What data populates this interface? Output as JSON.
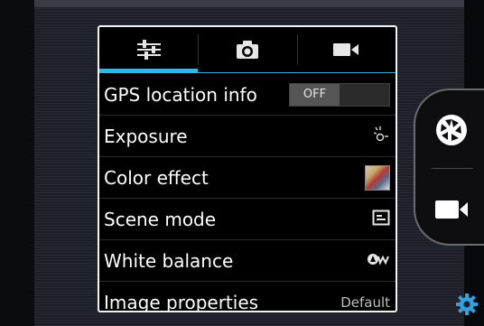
{
  "tabs": [
    {
      "icon": "settings-sliders-icon",
      "active": true
    },
    {
      "icon": "camera-icon",
      "active": false
    },
    {
      "icon": "video-camera-icon",
      "active": false
    }
  ],
  "settings": {
    "gps": {
      "label": "GPS location info",
      "value": "OFF"
    },
    "exposure": {
      "label": "Exposure",
      "icon": "exposure-icon"
    },
    "color_effect": {
      "label": "Color effect",
      "icon": "color-effect-thumbnail"
    },
    "scene_mode": {
      "label": "Scene mode",
      "icon": "scene-mode-icon"
    },
    "white_balance": {
      "label": "White balance",
      "icon": "auto-white-balance-icon"
    },
    "image_properties": {
      "label": "Image properties",
      "value": "Default"
    }
  },
  "controls": {
    "shutter_icon": "shutter-icon",
    "video_icon": "video-camera-icon",
    "settings_icon": "gear-icon"
  },
  "colors": {
    "accent": "#33b5e5",
    "panel_bg": "#000000",
    "panel_border": "#f2f2f2",
    "settings_gear": "#33a0e0"
  }
}
